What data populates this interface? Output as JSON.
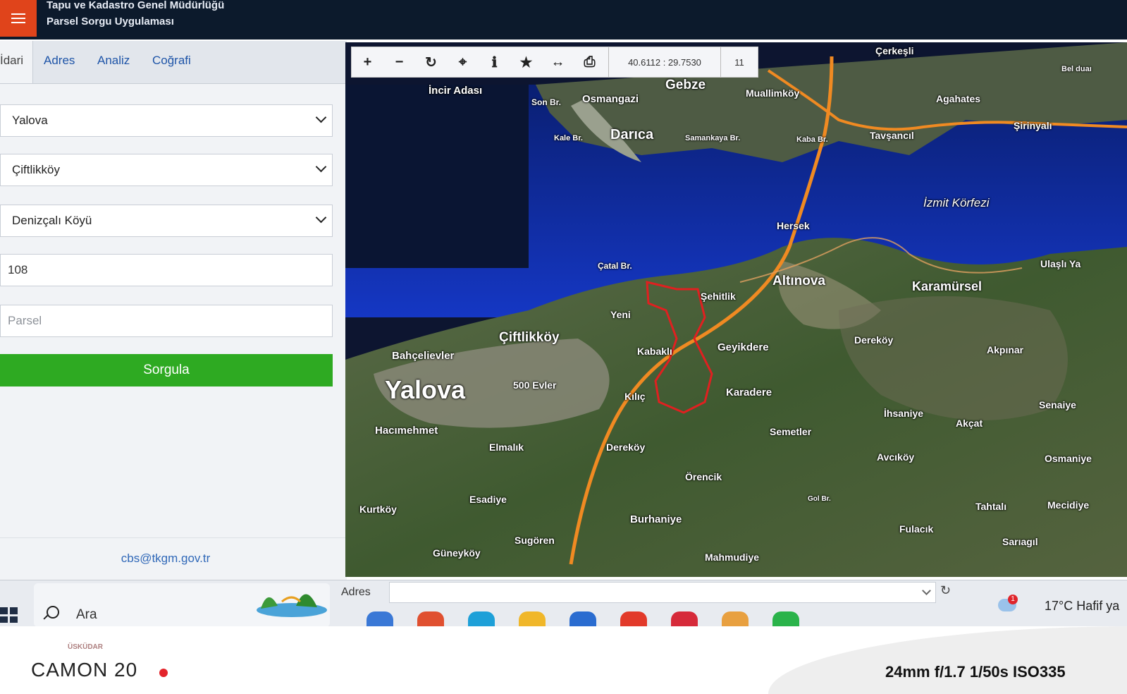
{
  "header": {
    "title_line1": "Tapu ve Kadastro Genel Müdürlüğü",
    "title_line2": "Parsel Sorgu Uygulaması"
  },
  "tabs": [
    "İdari",
    "Adres",
    "Analiz",
    "Coğrafi"
  ],
  "form": {
    "province": "Yalova",
    "district": "Çiftlikköy",
    "neighborhood": "Denizçalı Köyü",
    "block": "108",
    "parcel_placeholder": "Parsel",
    "query_button": "Sorgula"
  },
  "contact_email": "cbs@tkgm.gov.tr",
  "map": {
    "coordinates": "40.6112 : 29.7530",
    "zoom": "11",
    "labels": [
      "Çerkeşli",
      "Bel duaı",
      "İncir Adası",
      "Gebze",
      "Muallimköy",
      "Son Br.",
      "Osmangazi",
      "Darıca",
      "Kale Br.",
      "Samankaya Br.",
      "Kaba Br.",
      "Tavşancıl",
      "Agahates",
      "Şirinyalı",
      "İzmit Körfezi",
      "Hersek",
      "Çatal Br.",
      "Altınova",
      "Şehitlik",
      "Karamürsel",
      "Ulaşlı Ya",
      "Yeni",
      "Çiftlikköy",
      "Kabaklı",
      "Geyikdere",
      "Dereköy",
      "Akpınar",
      "Bahçelievler",
      "Yalova",
      "500 Evler",
      "Kılıç",
      "Karadere",
      "İhsaniye",
      "Senaiye",
      "Hacımehmet",
      "Semetler",
      "Akçat",
      "Elmalık",
      "Dereköy",
      "Avcıköy",
      "Osmaniye",
      "Örencik",
      "Esadiye",
      "Kurtköy",
      "Burhaniye",
      "Tahtalı",
      "Mecidiye",
      "Fulacık",
      "Sugören",
      "Sarıagıl",
      "Güneyköy",
      "Mahmudiye",
      "Gol Br."
    ]
  },
  "taskbar": {
    "search_label": "Ara",
    "address_label": "Adres",
    "weather": "17°C  Hafif ya",
    "notification_count": "1"
  },
  "photo_frame": {
    "brand": "CAMON 20",
    "logo_text": "ÜSKÜDAR",
    "camera_info": "24mm f/1.7 1/50s ISO335"
  }
}
